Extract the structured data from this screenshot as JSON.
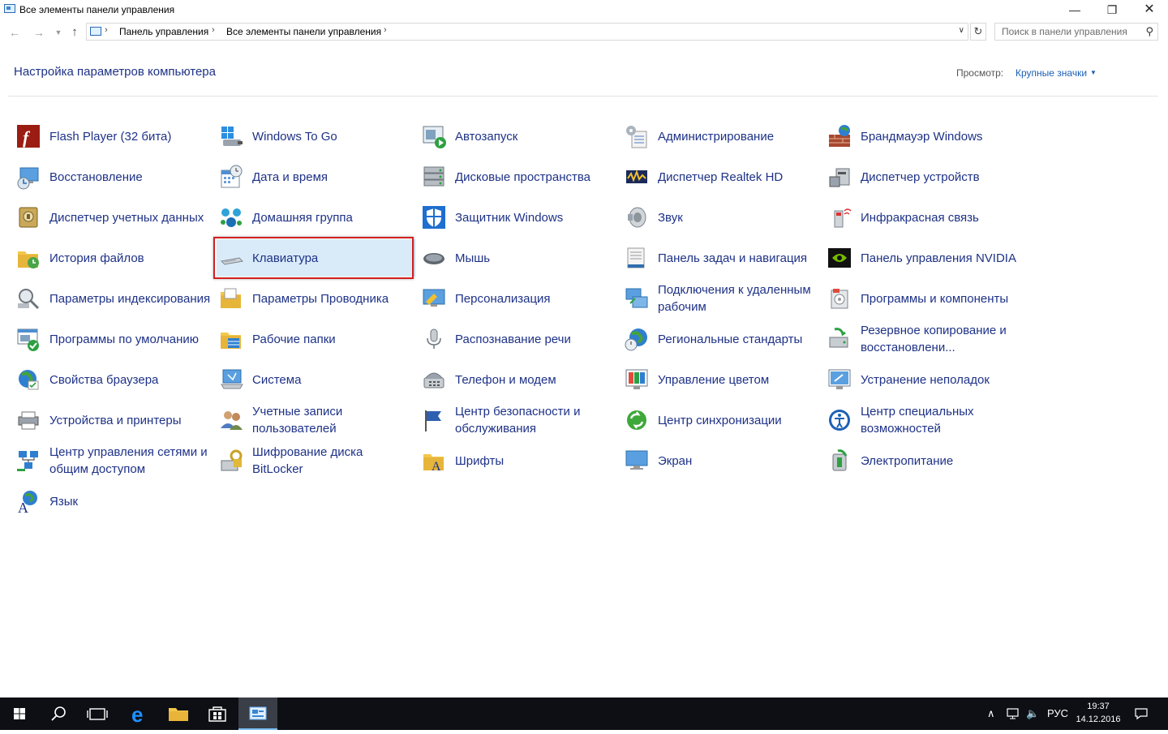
{
  "window": {
    "title": "Все элементы панели управления"
  },
  "address": {
    "crumbs": [
      "Панель управления",
      "Все элементы панели управления"
    ],
    "search_placeholder": "Поиск в панели управления"
  },
  "header": {
    "heading": "Настройка параметров компьютера",
    "view_label": "Просмотр:",
    "view_value": "Крупные значки"
  },
  "items": [
    {
      "label": "Flash Player (32 бита)",
      "icon": "flash-player-icon"
    },
    {
      "label": "Windows To Go",
      "icon": "windows-to-go-icon"
    },
    {
      "label": "Автозапуск",
      "icon": "autoplay-icon"
    },
    {
      "label": "Администрирование",
      "icon": "admin-tools-icon"
    },
    {
      "label": "Брандмауэр Windows",
      "icon": "firewall-icon"
    },
    {
      "label": "Восстановление",
      "icon": "recovery-icon"
    },
    {
      "label": "Дата и время",
      "icon": "date-time-icon"
    },
    {
      "label": "Дисковые пространства",
      "icon": "storage-spaces-icon"
    },
    {
      "label": "Диспетчер Realtek HD",
      "icon": "realtek-icon"
    },
    {
      "label": "Диспетчер устройств",
      "icon": "device-manager-icon"
    },
    {
      "label": "Диспетчер учетных данных",
      "icon": "credential-manager-icon"
    },
    {
      "label": "Домашняя группа",
      "icon": "homegroup-icon"
    },
    {
      "label": "Защитник Windows",
      "icon": "defender-icon"
    },
    {
      "label": "Звук",
      "icon": "sound-icon"
    },
    {
      "label": "Инфракрасная связь",
      "icon": "infrared-icon"
    },
    {
      "label": "История файлов",
      "icon": "file-history-icon"
    },
    {
      "label": "Клавиатура",
      "icon": "keyboard-icon"
    },
    {
      "label": "Мышь",
      "icon": "mouse-icon"
    },
    {
      "label": "Панель задач и навигация",
      "icon": "taskbar-navigation-icon"
    },
    {
      "label": "Панель управления NVIDIA",
      "icon": "nvidia-icon"
    },
    {
      "label": "Параметры индексирования",
      "icon": "indexing-icon"
    },
    {
      "label": "Параметры Проводника",
      "icon": "explorer-options-icon"
    },
    {
      "label": "Персонализация",
      "icon": "personalization-icon"
    },
    {
      "label": "Подключения к удаленным рабочим",
      "icon": "remote-desktop-icon"
    },
    {
      "label": "Программы и компоненты",
      "icon": "programs-features-icon"
    },
    {
      "label": "Программы по умолчанию",
      "icon": "default-programs-icon"
    },
    {
      "label": "Рабочие папки",
      "icon": "work-folders-icon"
    },
    {
      "label": "Распознавание речи",
      "icon": "speech-recognition-icon"
    },
    {
      "label": "Региональные стандарты",
      "icon": "region-icon"
    },
    {
      "label": "Резервное копирование и восстановлени...",
      "icon": "backup-restore-icon"
    },
    {
      "label": "Свойства браузера",
      "icon": "internet-options-icon"
    },
    {
      "label": "Система",
      "icon": "system-icon"
    },
    {
      "label": "Телефон и модем",
      "icon": "phone-modem-icon"
    },
    {
      "label": "Управление цветом",
      "icon": "color-management-icon"
    },
    {
      "label": "Устранение неполадок",
      "icon": "troubleshooting-icon"
    },
    {
      "label": "Устройства и принтеры",
      "icon": "devices-printers-icon"
    },
    {
      "label": "Учетные записи пользователей",
      "icon": "user-accounts-icon"
    },
    {
      "label": "Центр безопасности и обслуживания",
      "icon": "security-maintenance-icon"
    },
    {
      "label": "Центр синхронизации",
      "icon": "sync-center-icon"
    },
    {
      "label": "Центр специальных возможностей",
      "icon": "ease-of-access-icon"
    },
    {
      "label": "Центр управления сетями и общим доступом",
      "icon": "network-sharing-icon"
    },
    {
      "label": "Шифрование диска BitLocker",
      "icon": "bitlocker-icon"
    },
    {
      "label": "Шрифты",
      "icon": "fonts-icon"
    },
    {
      "label": "Экран",
      "icon": "display-icon"
    },
    {
      "label": "Электропитание",
      "icon": "power-options-icon"
    },
    {
      "label": "Язык",
      "icon": "language-icon"
    }
  ],
  "selected_item": "Клавиатура",
  "taskbar": {
    "language": "РУС",
    "time": "19:37",
    "date": "14.12.2016"
  }
}
